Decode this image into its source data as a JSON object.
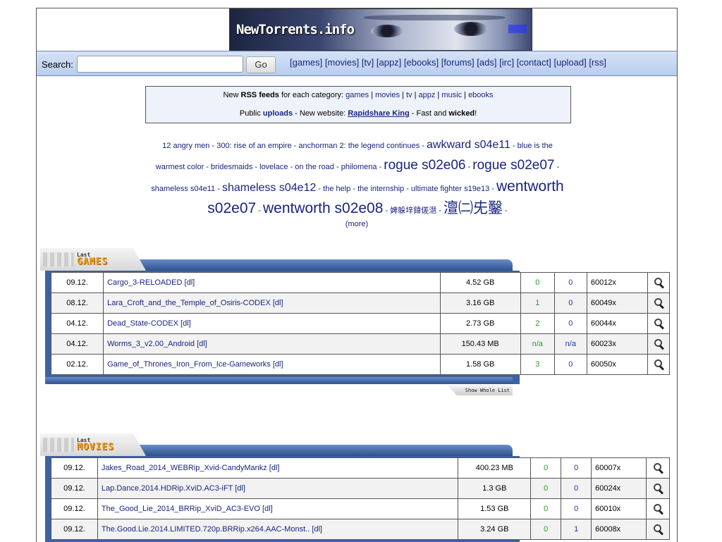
{
  "logo_text": "NewTorrents.info",
  "search": {
    "label": "Search:",
    "value": "",
    "go_label": "Go"
  },
  "categories": [
    "[games]",
    "[movies]",
    "[tv]",
    "[appz]",
    "[ebooks]",
    "[forums]",
    "[ads]",
    "[irc]",
    "[contact]",
    "[upload]",
    "[rss]"
  ],
  "info": {
    "line1": {
      "prefix": "New ",
      "rss": "RSS feeds",
      "middle": " for each category: ",
      "links": [
        "games",
        "movies",
        "tv",
        "appz",
        "music",
        "ebooks"
      ]
    },
    "line2": {
      "public": "Public ",
      "uploads": "uploads",
      "sep1": " - New website: ",
      "rapid": "Rapidshare King",
      "sep2": " - Fast and ",
      "wicked": "wicked",
      "end": "!"
    }
  },
  "tagcloud": [
    {
      "text": "12 angry men",
      "size": "s11"
    },
    {
      "text": "300: rise of an empire",
      "size": "s11"
    },
    {
      "text": "anchorman 2: the legend continues",
      "size": "s11"
    },
    {
      "text": "awkward s04e11",
      "size": "s16"
    },
    {
      "text": "blue is the warmest color",
      "size": "s11"
    },
    {
      "text": "bridesmaids",
      "size": "s11"
    },
    {
      "text": "lovelace",
      "size": "s11"
    },
    {
      "text": "on the road",
      "size": "s11"
    },
    {
      "text": "philomena",
      "size": "s11"
    },
    {
      "text": "rogue s02e06",
      "size": "s19"
    },
    {
      "text": "rogue s02e07",
      "size": "s19"
    },
    {
      "text": "shameless s04e11",
      "size": "s11"
    },
    {
      "text": "shameless s04e12",
      "size": "s16"
    },
    {
      "text": "the help",
      "size": "s11"
    },
    {
      "text": "the internship",
      "size": "s11"
    },
    {
      "text": "ultimate fighter s19e13",
      "size": "s11"
    },
    {
      "text": "wentworth s02e07",
      "size": "s21"
    },
    {
      "text": "wentworth s02e08",
      "size": "s21"
    },
    {
      "text": "婢躲垶鍏傞潖",
      "size": "s11"
    },
    {
      "text": "澶㈡兂鑿",
      "size": "s21"
    }
  ],
  "more_label": "(more)",
  "games_section": {
    "tab_top": "Last",
    "tab_bottom": "GAMES",
    "show_whole": "Show Whole List",
    "rows": [
      {
        "date": "09.12.",
        "name": "Cargo_3-RELOADED",
        "dl": "[dl]",
        "size": "4.52 GB",
        "seeds": "0",
        "leech": "0",
        "id": "60012x"
      },
      {
        "date": "08.12.",
        "name": "Lara_Croft_and_the_Temple_of_Osiris-CODEX",
        "dl": "[dl]",
        "size": "3.16 GB",
        "seeds": "1",
        "leech": "0",
        "id": "60049x"
      },
      {
        "date": "04.12.",
        "name": "Dead_State-CODEX",
        "dl": "[dl]",
        "size": "2.73 GB",
        "seeds": "2",
        "leech": "0",
        "id": "60044x"
      },
      {
        "date": "04.12.",
        "name": "Worms_3_v2.00_Android",
        "dl": "[dl]",
        "size": "150.43 MB",
        "seeds": "n/a",
        "leech": "n/a",
        "id": "60023x"
      },
      {
        "date": "02.12.",
        "name": "Game_of_Thrones_Iron_From_Ice-Gameworks",
        "dl": "[dl]",
        "size": "1.58 GB",
        "seeds": "3",
        "leech": "0",
        "id": "60050x"
      }
    ]
  },
  "movies_section": {
    "tab_top": "Last",
    "tab_bottom": "MOVIES",
    "rows": [
      {
        "date": "09.12.",
        "name": "Jakes_Road_2014_WEBRip_Xvid-CandyMankz",
        "dl": "[dl]",
        "size": "400.23 MB",
        "seeds": "0",
        "leech": "0",
        "id": "60007x"
      },
      {
        "date": "09.12.",
        "name": "Lap.Dance.2014.HDRip.XviD.AC3-iFT",
        "dl": "[dl]",
        "size": "1.3 GB",
        "seeds": "0",
        "leech": "0",
        "id": "60024x"
      },
      {
        "date": "09.12.",
        "name": "The_Good_Lie_2014_BRRip_XviD_AC3-EVO",
        "dl": "[dl]",
        "size": "1.53 GB",
        "seeds": "0",
        "leech": "0",
        "id": "60010x"
      },
      {
        "date": "09.12.",
        "name": "The.Good.Lie.2014.LIMITED.720p.BRRip.x264.AAC-Monst..",
        "dl": "[dl]",
        "size": "3.24 GB",
        "seeds": "0",
        "leech": "1",
        "id": "60008x"
      }
    ]
  }
}
